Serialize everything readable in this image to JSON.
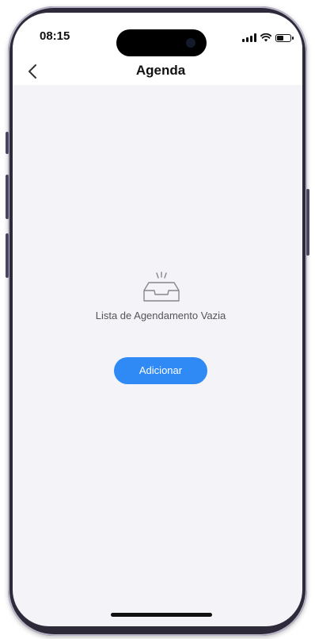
{
  "status_bar": {
    "time": "08:15",
    "icons": [
      "signal-icon",
      "wifi-icon",
      "battery-icon"
    ]
  },
  "nav": {
    "back_icon": "chevron-left-icon",
    "title": "Agenda"
  },
  "empty_state": {
    "icon": "empty-inbox-icon",
    "message": "Lista de Agendamento Vazia",
    "add_label": "Adicionar"
  },
  "colors": {
    "accent": "#2f8af5",
    "background": "#f3f3f8",
    "header": "#ffffff"
  }
}
